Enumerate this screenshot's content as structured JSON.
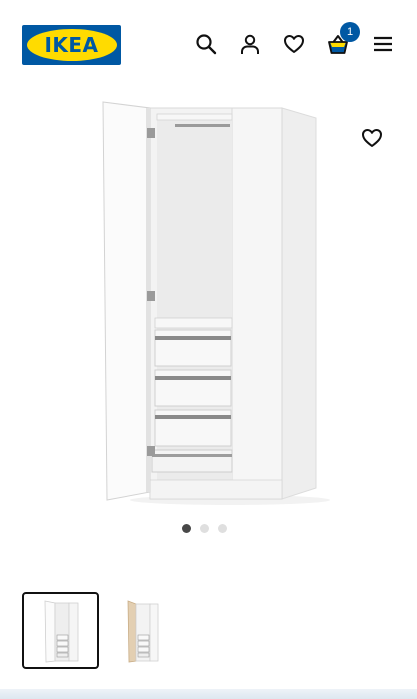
{
  "header": {
    "logo_text": "IKEA",
    "cart_count": "1",
    "icons": [
      "search-icon",
      "user-icon",
      "heart-icon",
      "shopping-bag-icon",
      "menu-icon"
    ]
  },
  "product": {
    "favourite_icon": "heart-icon",
    "image_count": 3,
    "active_image": 1,
    "thumbnails": [
      {
        "name": "white-wardrobe-thumbnail",
        "selected": true
      },
      {
        "name": "oak-wardrobe-thumbnail",
        "selected": false
      }
    ]
  },
  "colors": {
    "brand_blue": "#0058a3",
    "brand_yellow": "#ffdb00",
    "active_dot": "#484848",
    "inactive_dot": "#dfdfdf"
  }
}
